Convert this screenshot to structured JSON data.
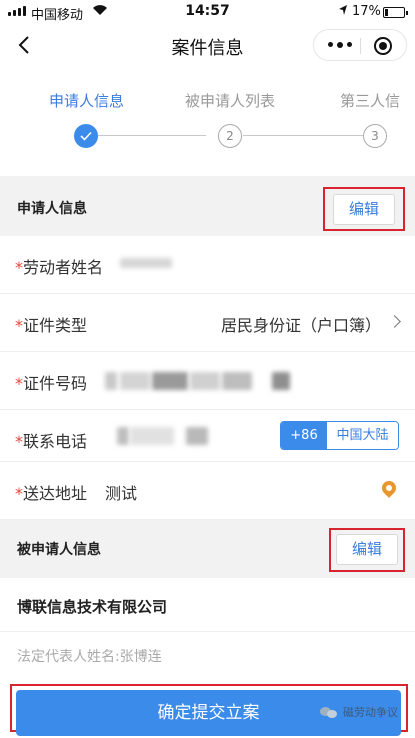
{
  "status_bar": {
    "carrier": "中国移动",
    "time": "14:57",
    "battery_text": "17%",
    "battery_level": 0.17
  },
  "nav": {
    "title": "案件信息"
  },
  "steps": {
    "tabs": [
      "申请人信息",
      "被申请人列表",
      "第三人信"
    ],
    "active": 0,
    "numbers": [
      "2",
      "3"
    ]
  },
  "applicant": {
    "section_label": "申请人信息",
    "edit_label": "编辑",
    "required_mark": "*",
    "name_label": "劳动者姓名",
    "id_type_label": "证件类型",
    "id_type_value": "居民身份证（户口簿）",
    "id_number_label": "证件号码",
    "phone_label": "联系电话",
    "country_code": "+86",
    "region": "中国大陆",
    "address_label": "送达地址",
    "address_value": "测试"
  },
  "respondent": {
    "section_label": "被申请人信息",
    "edit_label": "编辑",
    "company_name": "博联信息技术有限公司",
    "legal_rep": "法定代表人姓名:张博连"
  },
  "submit_label": "确定提交立案",
  "watermark": "磁劳动争议",
  "colors": {
    "accent": "#3b8beb",
    "required": "#e04a3a",
    "highlight": "#d9232e",
    "section_bg": "#f2f2f2"
  }
}
